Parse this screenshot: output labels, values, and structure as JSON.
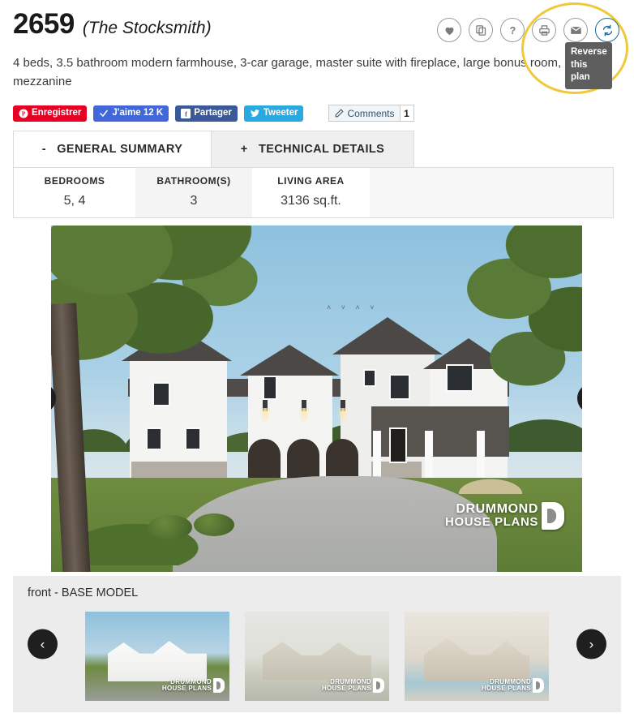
{
  "header": {
    "plan_number": "2659",
    "plan_name": "(The Stocksmith)",
    "description": "4 beds, 3.5 bathroom modern farmhouse, 3-car garage, master suite with fireplace, large bonus room, mezzanine"
  },
  "icon_bar": {
    "favorite": "heart-icon",
    "compare": "copy-icon",
    "help": "question-icon",
    "print": "printer-icon",
    "email": "envelope-icon",
    "reverse": "reverse-icon"
  },
  "tooltip": {
    "text": "Reverse this plan"
  },
  "social": {
    "pinterest_label": "Enregistrer",
    "facebook_like_label": "J'aime 12 K",
    "facebook_share_label": "Partager",
    "twitter_label": "Tweeter",
    "comments_label": "Comments",
    "comments_count": "1"
  },
  "tabs": [
    {
      "prefix": "-",
      "label": "GENERAL SUMMARY",
      "active": true
    },
    {
      "prefix": "+",
      "label": "TECHNICAL DETAILS",
      "active": false
    }
  ],
  "stats": [
    {
      "label": "BEDROOMS",
      "value": "5, 4"
    },
    {
      "label": "BATHROOM(S)",
      "value": "3"
    },
    {
      "label": "LIVING AREA",
      "value": "3136 sq.ft."
    }
  ],
  "gallery": {
    "caption": "front - BASE MODEL",
    "watermark_line1": "DRUMMOND",
    "watermark_line2": "HOUSE PLANS",
    "prev_label": "‹",
    "next_label": "›",
    "thumbnails": [
      {
        "watermark_line1": "DRUMMOND",
        "watermark_line2": "HOUSE PLANS"
      },
      {
        "watermark_line1": "DRUMMOND",
        "watermark_line2": "HOUSE PLANS"
      },
      {
        "watermark_line1": "DRUMMOND",
        "watermark_line2": "HOUSE PLANS"
      }
    ]
  },
  "colors": {
    "highlight_ring": "#efc93a",
    "accent_blue": "#1f6a96",
    "pinterest_red": "#e60023",
    "facebook_blue": "#4267d8",
    "facebook_share_blue": "#3b5998",
    "twitter_blue": "#29a9e0",
    "tooltip_bg": "#5e5e5e"
  }
}
